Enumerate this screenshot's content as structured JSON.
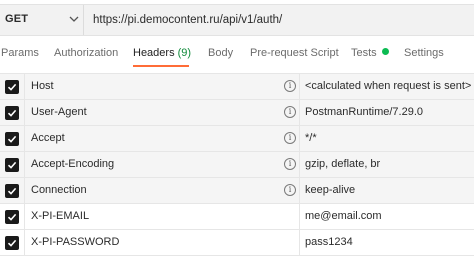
{
  "request": {
    "method": "GET",
    "url": "https://pi.democontent.ru/api/v1/auth/"
  },
  "tabs": [
    {
      "label": "Params",
      "active": false
    },
    {
      "label": "Authorization",
      "active": false
    },
    {
      "label": "Headers",
      "count": "(9)",
      "active": true
    },
    {
      "label": "Body",
      "active": false
    },
    {
      "label": "Pre-request Script",
      "active": false
    },
    {
      "label": "Tests",
      "active": false,
      "status_dot_color": "#0cbb52"
    },
    {
      "label": "Settings",
      "active": false
    }
  ],
  "accent_color": "#ff6c37",
  "info_icon_glyph": "i",
  "headers": [
    {
      "key": "Host",
      "value": "<calculated when request is sent>",
      "checked": true,
      "auto": true
    },
    {
      "key": "User-Agent",
      "value": "PostmanRuntime/7.29.0",
      "checked": true,
      "auto": true
    },
    {
      "key": "Accept",
      "value": "*/*",
      "checked": true,
      "auto": true
    },
    {
      "key": "Accept-Encoding",
      "value": "gzip, deflate, br",
      "checked": true,
      "auto": true
    },
    {
      "key": "Connection",
      "value": "keep-alive",
      "checked": true,
      "auto": true
    },
    {
      "key": "X-PI-EMAIL",
      "value": "me@email.com",
      "checked": true,
      "auto": false
    },
    {
      "key": "X-PI-PASSWORD",
      "value": "pass1234",
      "checked": true,
      "auto": false
    }
  ]
}
